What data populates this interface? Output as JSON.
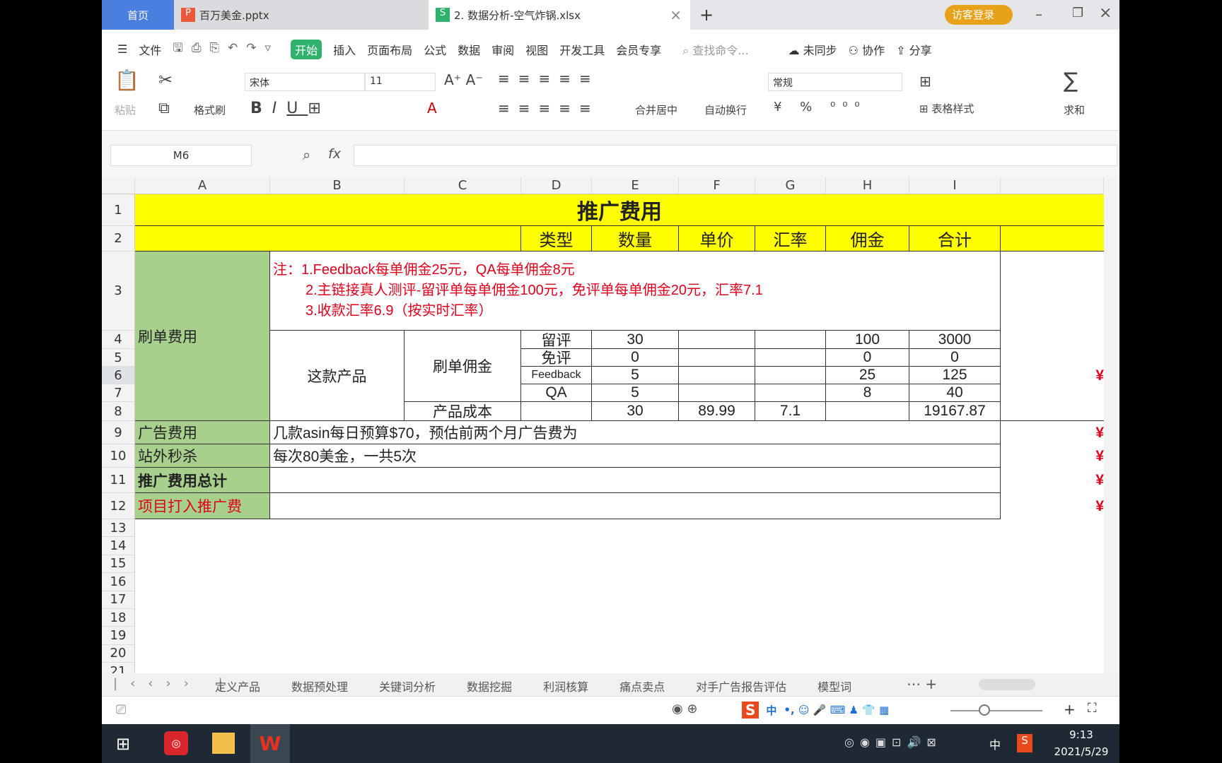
{
  "tabs": {
    "home": "首页",
    "t1": "百万美金.pptx",
    "t2": "2. 数据分析-空气炸锅.xlsx",
    "new": "+",
    "login": "访客登录"
  },
  "menu": {
    "file": "文件",
    "items": [
      "开始",
      "插入",
      "页面布局",
      "公式",
      "数据",
      "审阅",
      "视图",
      "开发工具",
      "会员专享"
    ],
    "search": "查找命令...",
    "sync": "未同步",
    "collab": "协作",
    "share": "分享"
  },
  "ribbon": {
    "paste": "粘贴",
    "format_painter": "格式刷",
    "font": "宋体",
    "size": "11",
    "merge": "合并居中",
    "wrap": "自动换行",
    "number_format": "常规",
    "table_style": "表格样式",
    "sum": "求和"
  },
  "formula": {
    "cell_ref": "M6",
    "fx": "fx",
    "value": ""
  },
  "columns": [
    "A",
    "B",
    "C",
    "D",
    "E",
    "F",
    "G",
    "H",
    "I"
  ],
  "rows": [
    "1",
    "2",
    "3",
    "4",
    "5",
    "6",
    "7",
    "8",
    "9",
    "10",
    "11",
    "12",
    "13",
    "14",
    "15",
    "16",
    "17",
    "18",
    "19",
    "20",
    "21"
  ],
  "sheet": {
    "title": "推广费用",
    "headers": [
      "类型",
      "数量",
      "单价",
      "汇率",
      "佣金",
      "合计"
    ],
    "a3": "刷单费用",
    "note1": "注：1.Feedback每单佣金25元，QA每单佣金8元",
    "note2": "2.主链接真人测评-留评单每单佣金100元，免评单每单佣金20元，汇率7.1",
    "note3": "3.收款汇率6.9（按实时汇率）",
    "b4": "这款产品",
    "c4": "刷单佣金",
    "items": [
      {
        "type": "留评",
        "qty": "30",
        "comm": "100",
        "total": "3000"
      },
      {
        "type": "免评",
        "qty": "0",
        "comm": "0",
        "total": "0"
      },
      {
        "type": "Feedback",
        "qty": "5",
        "comm": "25",
        "total": "125"
      },
      {
        "type": "QA",
        "qty": "5",
        "comm": "8",
        "total": "40"
      }
    ],
    "cost": {
      "label": "产品成本",
      "qty": "30",
      "price": "89.99",
      "rate": "7.1",
      "total": "19167.87"
    },
    "ads": {
      "label": "广告费用",
      "desc": "几款asin每日预算$70，预估前两个月广告费为"
    },
    "flash": {
      "label": "站外秒杀",
      "desc": "每次80美金，一共5次"
    },
    "total_label": "推广费用总计",
    "project_label": "项目打入推广费",
    "yen": "¥"
  },
  "sheet_tabs": [
    "定义产品",
    "数据预处理",
    "关键词分析",
    "数据挖掘",
    "利润核算",
    "痛点卖点",
    "对手广告报告评估",
    "模型词"
  ],
  "ime": {
    "lang": "中"
  },
  "taskbar": {
    "time": "9:13",
    "date": "2021/5/29",
    "lang": "中"
  },
  "colors": {
    "yellow": "#ffff00",
    "green": "#a8d08d",
    "red": "#e0001b",
    "accent": "#2fb36c"
  }
}
